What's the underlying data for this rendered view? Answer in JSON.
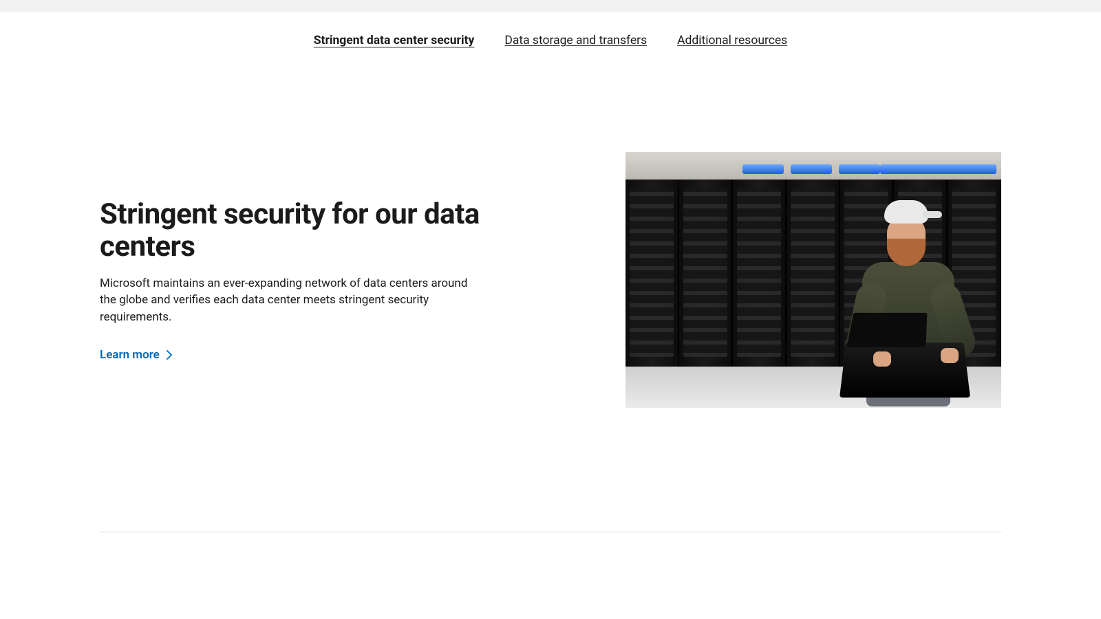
{
  "nav": {
    "items": [
      {
        "label": "Stringent data center security",
        "active": true
      },
      {
        "label": "Data storage and transfers",
        "active": false
      },
      {
        "label": "Additional resources",
        "active": false
      }
    ]
  },
  "hero": {
    "heading": "Stringent security for our data centers",
    "body": "Microsoft maintains an ever-expanding network of data centers around the globe and verifies each data center meets stringent security requirements.",
    "cta_label": "Learn more",
    "image_alt": "Technician with a laptop standing in front of server racks in a data center"
  },
  "colors": {
    "link": "#0067b8",
    "text": "#1b1b1b",
    "top_strip": "#f2f2f2",
    "divider": "#d6d6d6"
  }
}
